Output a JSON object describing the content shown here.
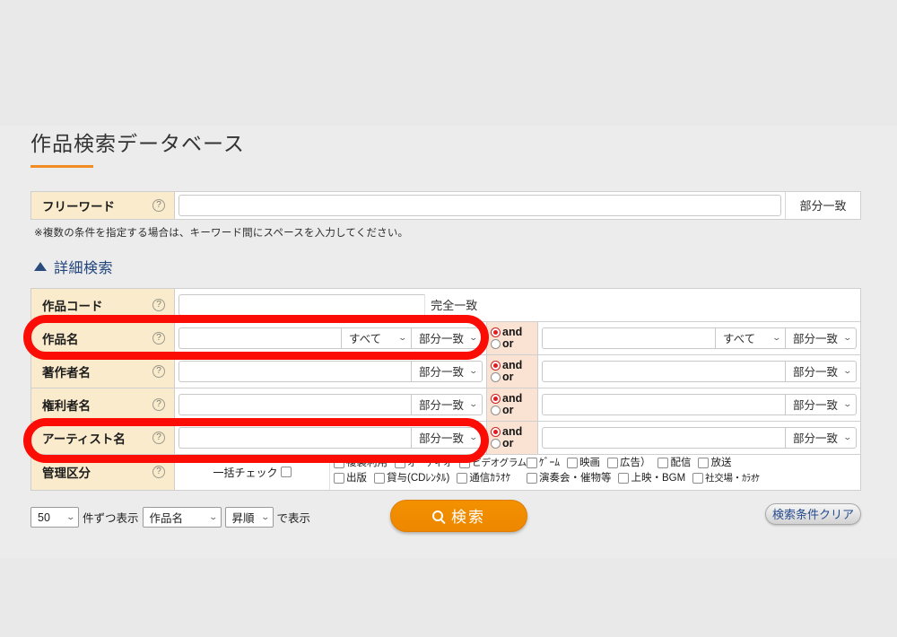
{
  "page": {
    "title": "作品検索データベース",
    "accent_color": "#f08c22",
    "annotation_color": "#fb0c05",
    "label_bg_color": "#faebcd",
    "andor_bg_color": "#fbe3d4"
  },
  "freeword": {
    "label": "フリーワード",
    "help_icon": "question-mark-icon",
    "value": "",
    "placeholder": "",
    "match_label": "部分一致",
    "note": "※複数の条件を指定する場合は、キーワード間にスペースを入力してください。"
  },
  "detail_toggle": {
    "icon": "triangle-up-icon",
    "label": "詳細検索"
  },
  "detail_rows": [
    {
      "label": "作品コード",
      "help_icon": "question-mark-icon",
      "primary_value": "",
      "has_scope_select": false,
      "match_type": "static",
      "match_label": "完全一致",
      "has_secondary": false,
      "annotated": false
    },
    {
      "label": "作品名",
      "help_icon": "question-mark-icon",
      "primary_value": "",
      "has_scope_select": true,
      "scope_label": "すべて",
      "match_type": "select",
      "match_label": "部分一致",
      "has_secondary": true,
      "andor": {
        "and_label": "and",
        "or_label": "or",
        "selected": "and"
      },
      "secondary_value": "",
      "secondary_has_scope_select": true,
      "secondary_scope_label": "すべて",
      "secondary_match_label": "部分一致",
      "annotated": true
    },
    {
      "label": "著作者名",
      "help_icon": "question-mark-icon",
      "primary_value": "",
      "has_scope_select": false,
      "match_type": "select",
      "match_label": "部分一致",
      "has_secondary": true,
      "andor": {
        "and_label": "and",
        "or_label": "or",
        "selected": "and"
      },
      "secondary_value": "",
      "secondary_has_scope_select": false,
      "secondary_match_label": "部分一致",
      "annotated": false
    },
    {
      "label": "権利者名",
      "help_icon": "question-mark-icon",
      "primary_value": "",
      "has_scope_select": false,
      "match_type": "select",
      "match_label": "部分一致",
      "has_secondary": true,
      "andor": {
        "and_label": "and",
        "or_label": "or",
        "selected": "and"
      },
      "secondary_value": "",
      "secondary_has_scope_select": false,
      "secondary_match_label": "部分一致",
      "annotated": false
    },
    {
      "label": "アーティスト名",
      "help_icon": "question-mark-icon",
      "primary_value": "",
      "has_scope_select": false,
      "match_type": "select",
      "match_label": "部分一致",
      "has_secondary": true,
      "andor": {
        "and_label": "and",
        "or_label": "or",
        "selected": "and"
      },
      "secondary_value": "",
      "secondary_has_scope_select": false,
      "secondary_match_label": "部分一致",
      "annotated": true
    }
  ],
  "kubun": {
    "label": "管理区分",
    "help_icon": "question-mark-icon",
    "check_all_label": "一括チェック",
    "group_left": {
      "row1": [
        "複製利用",
        "オーディオ",
        "ビデオグラム"
      ],
      "row2": [
        "出版",
        "貸与(CDﾚﾝﾀﾙ)",
        "通信ｶﾗｵｹ"
      ]
    },
    "group_right": {
      "row1": [
        "ｹﾞｰﾑ",
        "映画",
        "広告）",
        "配信",
        "放送"
      ],
      "row2": [
        "演奏会・催物等",
        "上映・BGM",
        "社交場・ｶﾗｵｹ"
      ]
    }
  },
  "toolbar": {
    "per_page_value": "50",
    "per_page_suffix": "件ずつ表示",
    "sort_key_value": "作品名",
    "sort_dir_value": "昇順",
    "sort_suffix": "で表示",
    "search_button_label": "検索",
    "search_button_icon": "magnifier-icon",
    "clear_button_label": "検索条件クリア"
  }
}
